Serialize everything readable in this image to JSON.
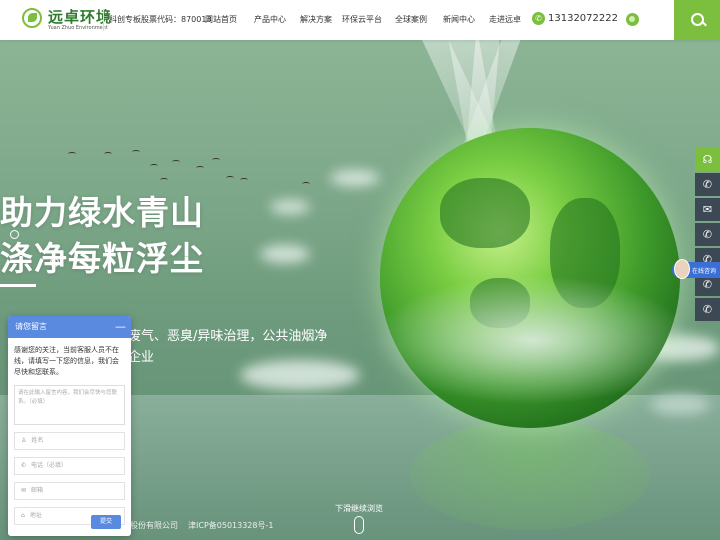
{
  "header": {
    "logo_cn": "远卓环境",
    "logo_en": "Yuan Zhuo Environment",
    "stock": "科创专板股票代码：870013",
    "nav": [
      "网站首页",
      "产品中心",
      "解决方案",
      "环保云平台",
      "全球案例",
      "新闻中心",
      "走进远卓"
    ],
    "phone": "13132072222"
  },
  "hero": {
    "slogan_line1": "助力绿水青山",
    "slogan_line2": "涤净每粒浮尘",
    "desc_line1": "废气、恶臭/异味治理，公共油烟净",
    "desc_line2": "企业",
    "scroll_hint": "下滑继续浏览"
  },
  "footer": {
    "company": "股份有限公司",
    "icp": "津ICP备05013328号-1"
  },
  "float": {
    "online_label": "在线咨询"
  },
  "chat": {
    "title": "请您留言",
    "minimize": "—",
    "notice": "感谢您的关注，当前客服人员不在线，请填写一下您的信息，我们会尽快和您联系。",
    "message_placeholder": "请在此输入留言内容，我们会尽快与您联系。（必填）",
    "name_placeholder": "姓名",
    "phone_placeholder": "电话（必填）",
    "email_placeholder": "邮箱",
    "address_placeholder": "地址",
    "submit": "提交"
  },
  "colors": {
    "brand_green": "#7cbf3f",
    "chat_blue": "#5a8ae0",
    "float_dark": "#3d4855"
  }
}
